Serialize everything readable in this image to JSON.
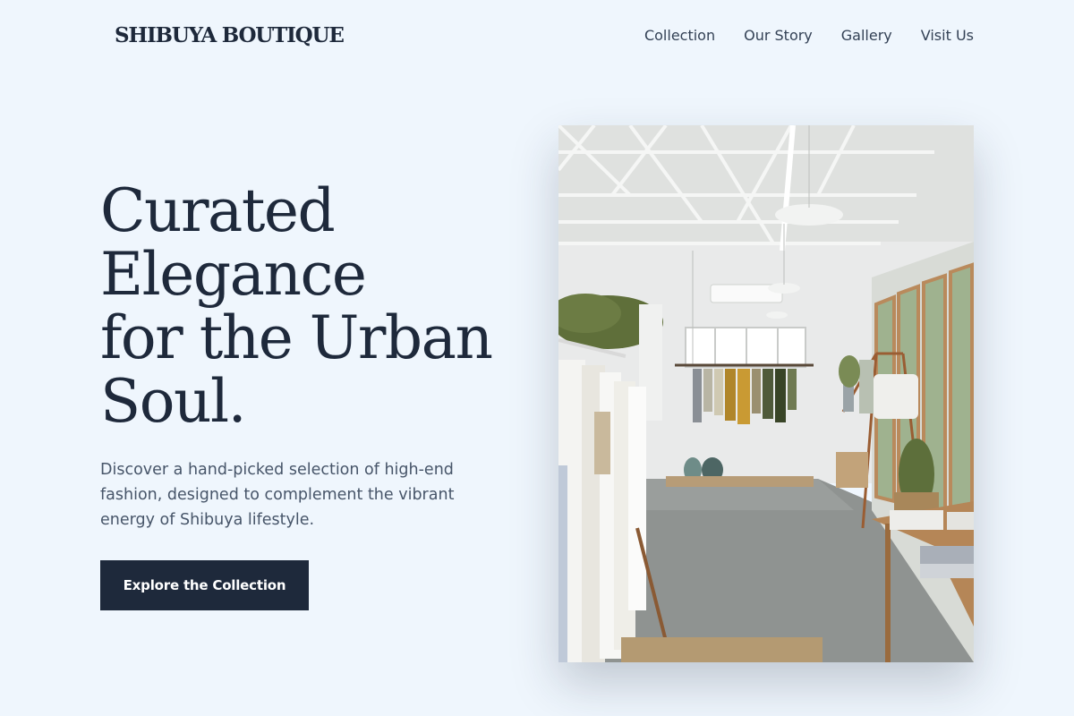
{
  "header": {
    "logo": "SHIBUYA BOUTIQUE",
    "nav": [
      {
        "label": "Collection"
      },
      {
        "label": "Our Story"
      },
      {
        "label": "Gallery"
      },
      {
        "label": "Visit Us"
      }
    ]
  },
  "hero": {
    "title_lines": [
      "Curated",
      "Elegance",
      "for the Urban",
      "Soul."
    ],
    "description": "Discover a hand-picked selection of high-end fashion, designed to complement the vibrant energy of Shibuya lifestyle.",
    "cta_label": "Explore the Collection"
  },
  "colors": {
    "background": "#eff6fd",
    "primary_text": "#1e293b",
    "muted_text": "#475569",
    "button_bg": "#1e293b",
    "button_text": "#ffffff"
  }
}
